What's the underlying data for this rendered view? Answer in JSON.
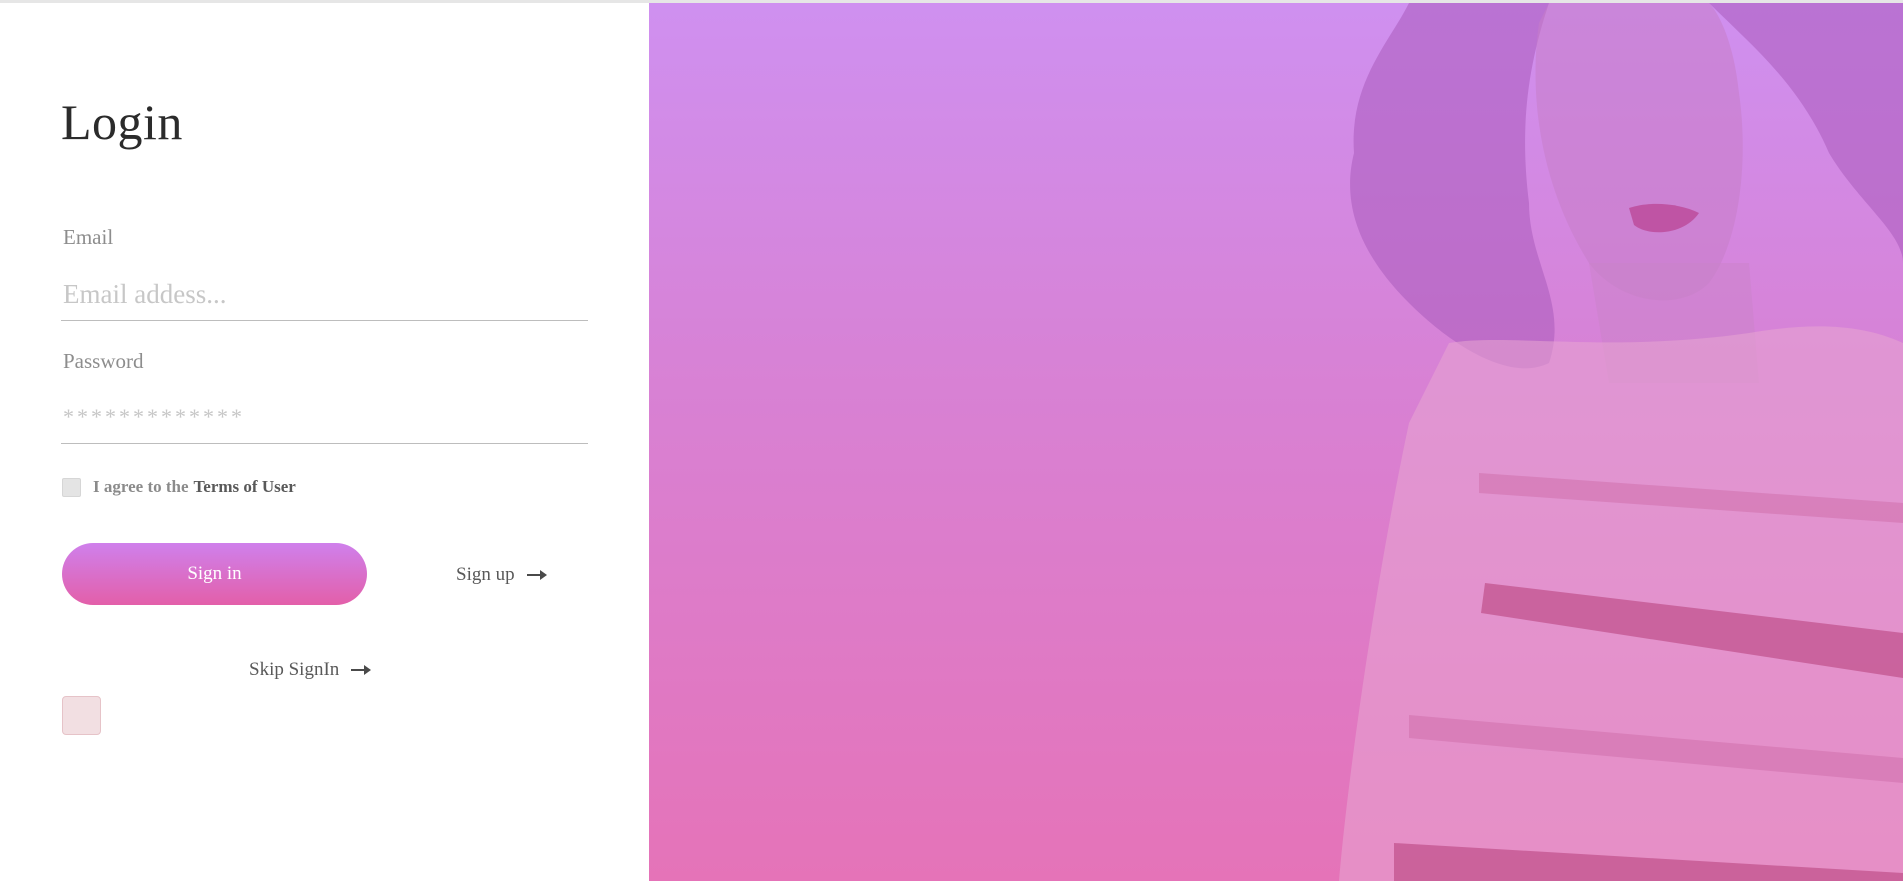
{
  "login": {
    "title": "Login",
    "email_label": "Email",
    "email_placeholder": "Email addess...",
    "password_label": "Password",
    "password_placeholder": "*************",
    "agree_text": "I agree to the",
    "terms_link": "Terms of User",
    "signin_label": "Sign in",
    "signup_label": "Sign up",
    "skip_label": "Skip SignIn"
  },
  "colors": {
    "accent_top": "#cf80ec",
    "accent_bottom": "#e35fa9",
    "panel_top": "#cf90f0",
    "panel_bottom": "#e573b8"
  },
  "icons": {
    "signup_arrow": "right-arrow-icon",
    "skip_arrow": "right-arrow-icon"
  },
  "hero": {
    "image": "woman-portrait-image"
  }
}
